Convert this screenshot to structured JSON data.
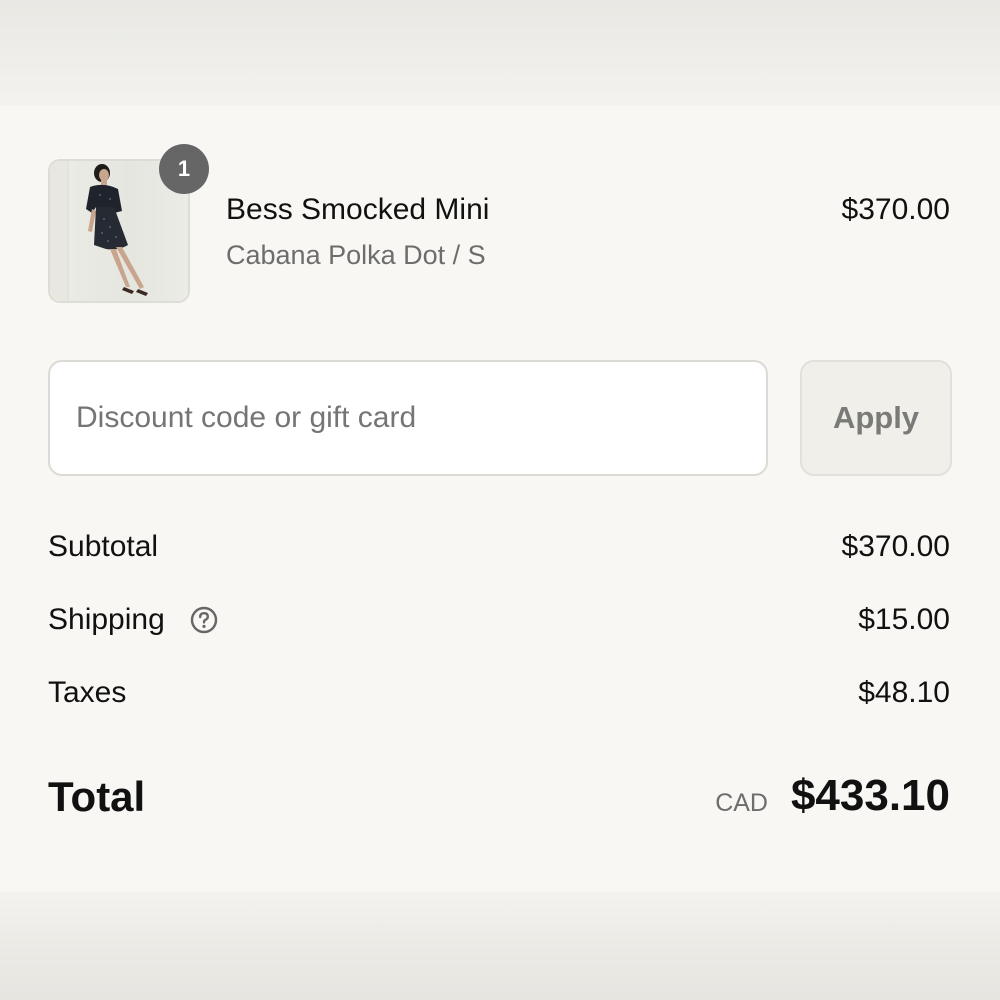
{
  "line_item": {
    "quantity": "1",
    "name": "Bess Smocked Mini",
    "variant": "Cabana Polka Dot / S",
    "price": "$370.00",
    "image": "product-photo-woman-in-dark-dress"
  },
  "discount": {
    "placeholder": "Discount code or gift card",
    "value": "",
    "apply_label": "Apply"
  },
  "summary": {
    "subtotal_label": "Subtotal",
    "subtotal_value": "$370.00",
    "shipping_label": "Shipping",
    "shipping_icon": "help-circle-icon",
    "shipping_value": "$15.00",
    "taxes_label": "Taxes",
    "taxes_value": "$48.10"
  },
  "total": {
    "label": "Total",
    "currency": "CAD",
    "value": "$433.10"
  },
  "colors": {
    "background": "#f8f7f3",
    "text": "#111111",
    "muted_text": "#6d6d6d",
    "badge": "#666666",
    "button_bg": "#f0efea"
  }
}
